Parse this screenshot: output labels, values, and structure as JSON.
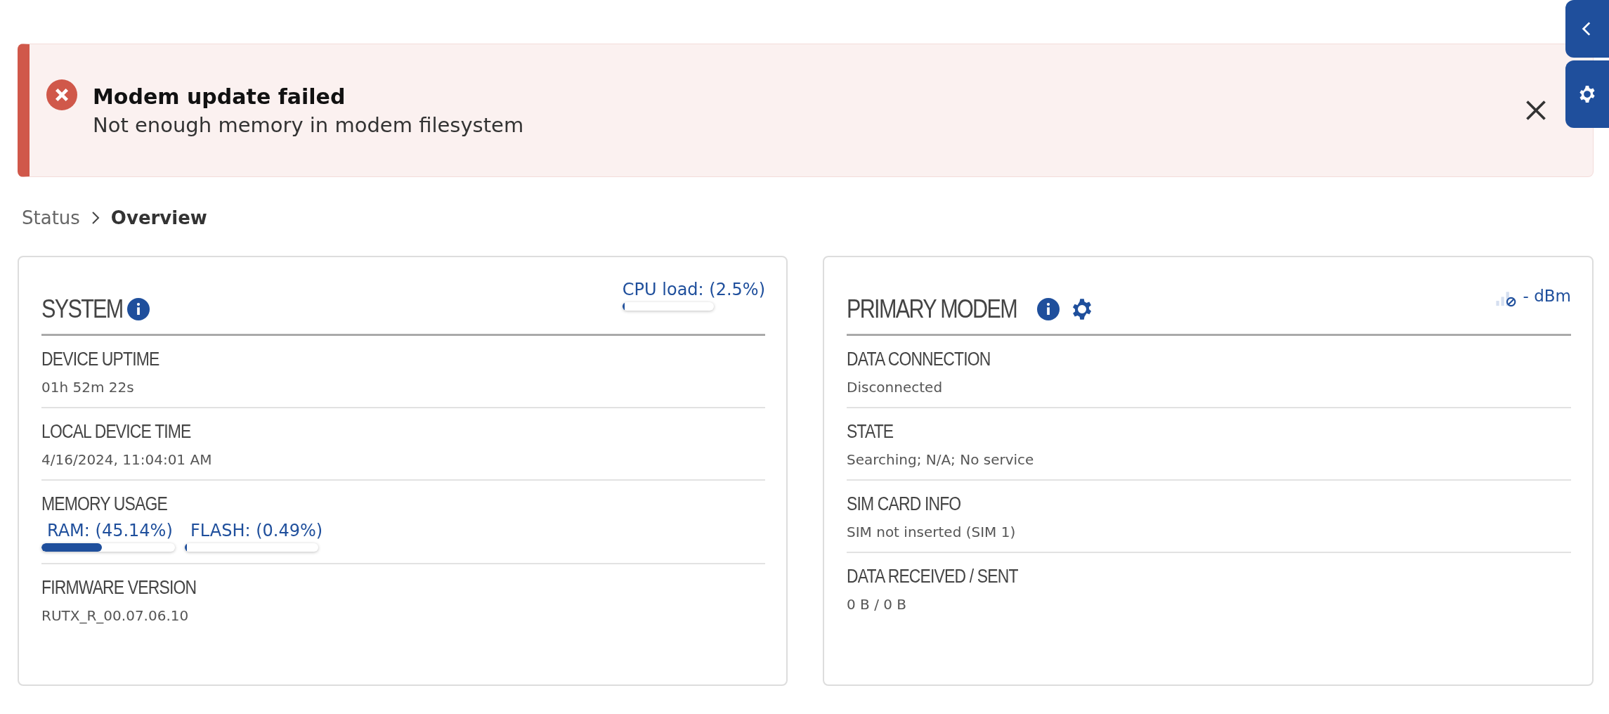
{
  "alert": {
    "title": "Modem update failed",
    "message": "Not enough memory in modem filesystem"
  },
  "breadcrumb": [
    {
      "label": "Status",
      "selected": false
    },
    {
      "label": "Overview",
      "selected": true
    }
  ],
  "system": {
    "title": "SYSTEM",
    "cpu": {
      "label": "CPU load: (2.5%)",
      "level": 0.025
    },
    "items": [
      {
        "kind": "text",
        "label": "DEVICE UPTIME",
        "value": "01h 52m 22s"
      },
      {
        "kind": "text",
        "label": "LOCAL DEVICE TIME",
        "value": "4/16/2024, 11:04:01 AM"
      },
      {
        "kind": "meters",
        "label": "MEMORY USAGE",
        "meters": [
          {
            "label": "RAM: (45.14%)",
            "level": 0.4514
          },
          {
            "label": "FLASH: (0.49%)",
            "level": 0.0049
          }
        ]
      },
      {
        "kind": "text",
        "label": "FIRMWARE VERSION",
        "value": "RUTX_R_00.07.06.10"
      }
    ]
  },
  "modem": {
    "title": "PRIMARY MODEM",
    "signal": "- dBm",
    "items": [
      {
        "kind": "text",
        "label": "DATA CONNECTION",
        "value": "Disconnected"
      },
      {
        "kind": "text",
        "label": "STATE",
        "value": "Searching; N/A; No service"
      },
      {
        "kind": "text",
        "label": "SIM CARD INFO",
        "value": "SIM not inserted (SIM 1)"
      },
      {
        "kind": "text",
        "label": "DATA RECEIVED / SENT",
        "value": "0 B / 0 B"
      }
    ]
  }
}
